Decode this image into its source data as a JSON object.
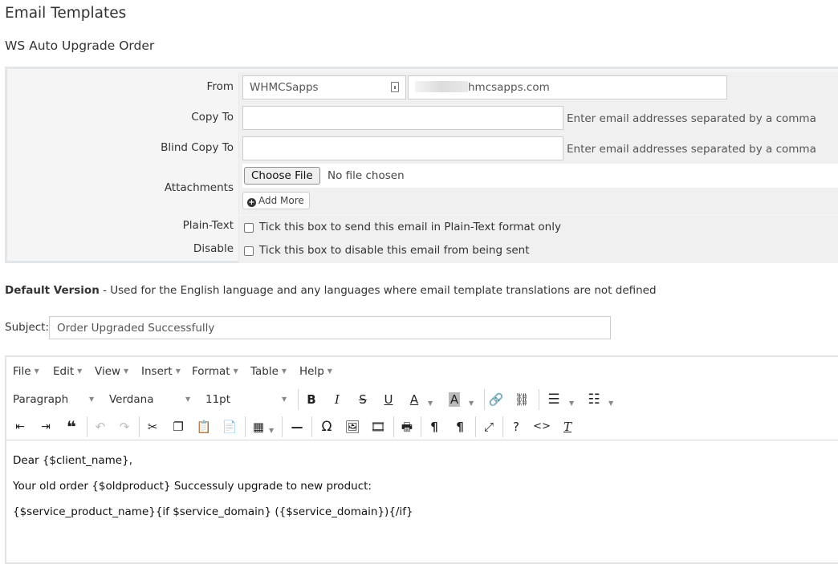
{
  "page": {
    "title": "Email Templates",
    "template_name": "WS Auto Upgrade Order"
  },
  "form": {
    "from_label": "From",
    "from_name": "WHMCSapps",
    "from_email_suffix": "hmcsapps.com",
    "copy_to_label": "Copy To",
    "copy_to_value": "",
    "copy_to_hint": "Enter email addresses separated by a comma",
    "bcc_label": "Blind Copy To",
    "bcc_value": "",
    "bcc_hint": "Enter email addresses separated by a comma",
    "attachments_label": "Attachments",
    "choose_file_label": "Choose File",
    "no_file_text": "No file chosen",
    "add_more_label": "Add More",
    "plaintext_label": "Plain-Text",
    "plaintext_text": "Tick this box to send this email in Plain-Text format only",
    "plaintext_checked": false,
    "disable_label": "Disable",
    "disable_text": "Tick this box to disable this email from being sent",
    "disable_checked": false
  },
  "version": {
    "heading": "Default Version",
    "description": " - Used for the English language and any languages where email template translations are not defined"
  },
  "subject": {
    "label": "Subject:",
    "value": "Order Upgraded Successfully"
  },
  "editor": {
    "menu": [
      "File",
      "Edit",
      "View",
      "Insert",
      "Format",
      "Table",
      "Help"
    ],
    "block_format": "Paragraph",
    "font_family": "Verdana",
    "font_size": "11pt",
    "content": [
      "Dear {$client_name},",
      "Your old order {$oldproduct} Successuly upgrade to new product:",
      "{$service_product_name}{if $service_domain} ({$service_domain}){/if}"
    ]
  },
  "colors": {
    "arrow": "#e8141b",
    "panel_bg": "#f5f5f5",
    "panel_border": "#e3e6e8"
  }
}
